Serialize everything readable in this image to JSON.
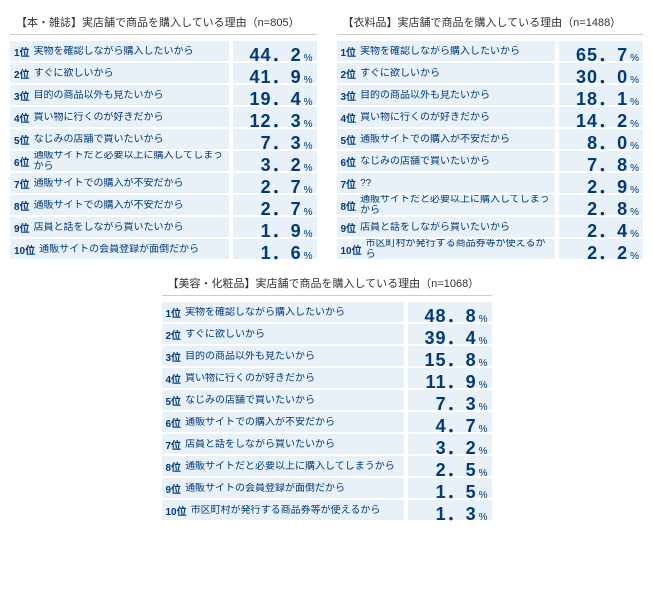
{
  "chart_data": [
    {
      "type": "table",
      "title": "【本・雑誌】実店舗で商品を購入している理由（n=805）",
      "rows": [
        {
          "rank": "1位",
          "reason": "実物を確認しながら購入したいから",
          "value": "44．2",
          "pct": "%"
        },
        {
          "rank": "2位",
          "reason": "すぐに欲しいから",
          "value": "41．9",
          "pct": "%"
        },
        {
          "rank": "3位",
          "reason": "目的の商品以外も見たいから",
          "value": "19．4",
          "pct": "%"
        },
        {
          "rank": "4位",
          "reason": "買い物に行くのが好きだから",
          "value": "12．3",
          "pct": "%"
        },
        {
          "rank": "5位",
          "reason": "なじみの店舗で買いたいから",
          "value": "7．3",
          "pct": "%"
        },
        {
          "rank": "6位",
          "reason": "通販サイトだと必要以上に購入してしまうから",
          "value": "3．2",
          "pct": "%"
        },
        {
          "rank": "7位",
          "reason": "通販サイトでの購入が不安だから",
          "value": "2．7",
          "pct": "%"
        },
        {
          "rank": "8位",
          "reason": "通販サイトでの購入が不安だから",
          "value": "2．7",
          "pct": "%"
        },
        {
          "rank": "9位",
          "reason": "店員と話をしながら買いたいから",
          "value": "1．9",
          "pct": "%"
        },
        {
          "rank": "10位",
          "reason": "通販サイトの会員登録が面倒だから",
          "value": "1．6",
          "pct": "%"
        }
      ]
    },
    {
      "type": "table",
      "title": "【衣料品】実店舗で商品を購入している理由（n=1488）",
      "rows": [
        {
          "rank": "1位",
          "reason": "実物を確認しながら購入したいから",
          "value": "65．7",
          "pct": "%"
        },
        {
          "rank": "2位",
          "reason": "すぐに欲しいから",
          "value": "30．0",
          "pct": "%"
        },
        {
          "rank": "3位",
          "reason": "目的の商品以外も見たいから",
          "value": "18．1",
          "pct": "%"
        },
        {
          "rank": "4位",
          "reason": "買い物に行くのが好きだから",
          "value": "14．2",
          "pct": "%"
        },
        {
          "rank": "5位",
          "reason": "通販サイトでの購入が不安だから",
          "value": "8．0",
          "pct": "%"
        },
        {
          "rank": "6位",
          "reason": "なじみの店舗で買いたいから",
          "value": "7．8",
          "pct": "%"
        },
        {
          "rank": "7位",
          "reason": "??",
          "value": "2．9",
          "pct": "%"
        },
        {
          "rank": "8位",
          "reason": "通販サイトだと必要以上に購入してしまうから",
          "value": "2．8",
          "pct": "%"
        },
        {
          "rank": "9位",
          "reason": "店員と話をしながら買いたいから",
          "value": "2．4",
          "pct": "%"
        },
        {
          "rank": "10位",
          "reason": "市区町村が発行する商品券等が使えるから",
          "value": "2．2",
          "pct": "%"
        }
      ]
    },
    {
      "type": "table",
      "title": "【美容・化粧品】実店舗で商品を購入している理由（n=1068）",
      "rows": [
        {
          "rank": "1位",
          "reason": "実物を確認しながら購入したいから",
          "value": "48．8",
          "pct": "%"
        },
        {
          "rank": "2位",
          "reason": "すぐに欲しいから",
          "value": "39．4",
          "pct": "%"
        },
        {
          "rank": "3位",
          "reason": "目的の商品以外も見たいから",
          "value": "15．8",
          "pct": "%"
        },
        {
          "rank": "4位",
          "reason": "買い物に行くのが好きだから",
          "value": "11．9",
          "pct": "%"
        },
        {
          "rank": "5位",
          "reason": "なじみの店舗で買いたいから",
          "value": "7．3",
          "pct": "%"
        },
        {
          "rank": "6位",
          "reason": "通販サイトでの購入が不安だから",
          "value": "4．7",
          "pct": "%"
        },
        {
          "rank": "7位",
          "reason": "店員と話をしながら買いたいから",
          "value": "3．2",
          "pct": "%"
        },
        {
          "rank": "8位",
          "reason": "通販サイトだと必要以上に購入してしまうから",
          "value": "2．5",
          "pct": "%"
        },
        {
          "rank": "9位",
          "reason": "通販サイトの会員登録が面倒だから",
          "value": "1．5",
          "pct": "%"
        },
        {
          "rank": "10位",
          "reason": "市区町村が発行する商品券等が使えるから",
          "value": "1．3",
          "pct": "%"
        }
      ]
    }
  ]
}
